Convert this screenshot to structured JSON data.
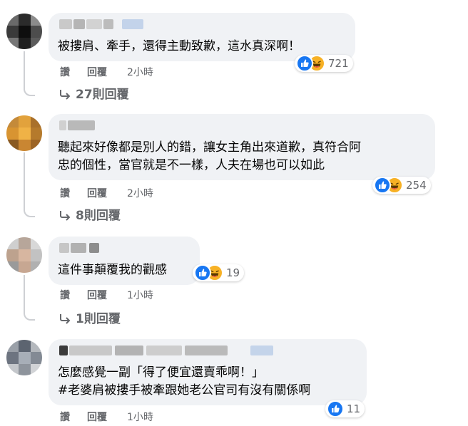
{
  "comments": [
    {
      "lines": [
        "被摟肩、牽手，還得主動致歉，這水真深啊！"
      ],
      "reactions": {
        "types": [
          "like-icon",
          "haha-icon"
        ],
        "count": "721"
      },
      "actions": {
        "like": "讚",
        "reply": "回覆",
        "time": "2小時"
      },
      "replies": "27則回覆"
    },
    {
      "lines": [
        "聽起來好像都是別人的錯，讓女主角出來道歉，真符合阿",
        "忠的個性，當官就是不一樣，人夫在場也可以如此"
      ],
      "reactions": {
        "types": [
          "like-icon",
          "haha-icon"
        ],
        "count": "254"
      },
      "actions": {
        "like": "讚",
        "reply": "回覆",
        "time": "2小時"
      },
      "replies": "8則回覆"
    },
    {
      "lines": [
        "這件事顛覆我的觀感"
      ],
      "reactions": {
        "types": [
          "like-icon",
          "haha-icon"
        ],
        "count": "19"
      },
      "actions": {
        "like": "讚",
        "reply": "回覆",
        "time": "1小時"
      },
      "replies": "1則回覆"
    },
    {
      "lines": [
        "怎麼感覺一副「得了便宜還賣乖啊！」",
        "#老婆肩被摟手被牽跟她老公官司有沒有關係啊"
      ],
      "reactions": {
        "types": [
          "like-icon"
        ],
        "count": "11"
      },
      "actions": {
        "like": "讚",
        "reply": "回覆",
        "time": "1小時"
      }
    }
  ],
  "colors": {
    "bubble": "#f0f2f5",
    "meta_text": "#65676b",
    "like_blue": "#1877f2",
    "haha_yellow": "#f7b125",
    "thread_line": "#ced0d4"
  }
}
